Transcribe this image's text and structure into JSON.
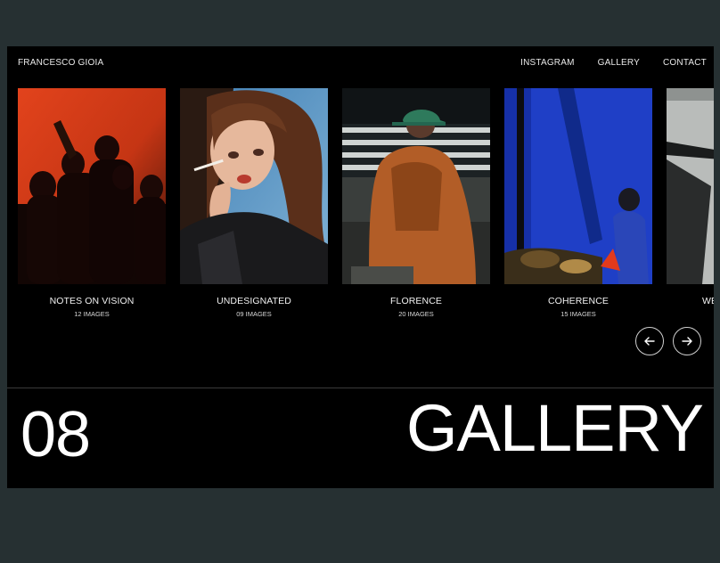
{
  "header": {
    "brand": "FRANCESCO GIOIA",
    "nav": [
      "INSTAGRAM",
      "GALLERY",
      "CONTACT"
    ]
  },
  "gallery": {
    "items": [
      {
        "title": "NOTES ON VISION",
        "count": "12 IMAGES"
      },
      {
        "title": "UNDESIGNATED",
        "count": "09 IMAGES"
      },
      {
        "title": "FLORENCE",
        "count": "20 IMAGES"
      },
      {
        "title": "COHERENCE",
        "count": "15 IMAGES"
      },
      {
        "title": "WE",
        "count": ""
      }
    ]
  },
  "section": {
    "number": "08",
    "title": "GALLERY"
  },
  "colors": {
    "outer_background": "#263032",
    "frame_background": "#000000",
    "text": "#ffffff"
  },
  "icons": {
    "prev": "arrow-left-icon",
    "next": "arrow-right-icon"
  }
}
